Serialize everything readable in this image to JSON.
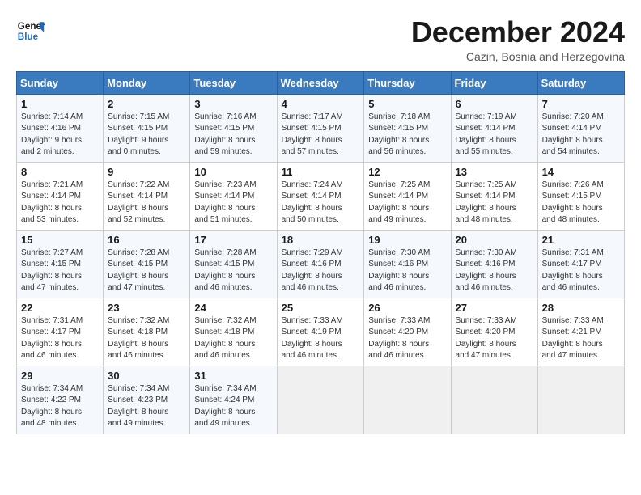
{
  "header": {
    "logo_general": "General",
    "logo_blue": "Blue",
    "month_title": "December 2024",
    "location": "Cazin, Bosnia and Herzegovina"
  },
  "calendar": {
    "days_of_week": [
      "Sunday",
      "Monday",
      "Tuesday",
      "Wednesday",
      "Thursday",
      "Friday",
      "Saturday"
    ],
    "weeks": [
      [
        {
          "day": "1",
          "info": "Sunrise: 7:14 AM\nSunset: 4:16 PM\nDaylight: 9 hours\nand 2 minutes."
        },
        {
          "day": "2",
          "info": "Sunrise: 7:15 AM\nSunset: 4:15 PM\nDaylight: 9 hours\nand 0 minutes."
        },
        {
          "day": "3",
          "info": "Sunrise: 7:16 AM\nSunset: 4:15 PM\nDaylight: 8 hours\nand 59 minutes."
        },
        {
          "day": "4",
          "info": "Sunrise: 7:17 AM\nSunset: 4:15 PM\nDaylight: 8 hours\nand 57 minutes."
        },
        {
          "day": "5",
          "info": "Sunrise: 7:18 AM\nSunset: 4:15 PM\nDaylight: 8 hours\nand 56 minutes."
        },
        {
          "day": "6",
          "info": "Sunrise: 7:19 AM\nSunset: 4:14 PM\nDaylight: 8 hours\nand 55 minutes."
        },
        {
          "day": "7",
          "info": "Sunrise: 7:20 AM\nSunset: 4:14 PM\nDaylight: 8 hours\nand 54 minutes."
        }
      ],
      [
        {
          "day": "8",
          "info": "Sunrise: 7:21 AM\nSunset: 4:14 PM\nDaylight: 8 hours\nand 53 minutes."
        },
        {
          "day": "9",
          "info": "Sunrise: 7:22 AM\nSunset: 4:14 PM\nDaylight: 8 hours\nand 52 minutes."
        },
        {
          "day": "10",
          "info": "Sunrise: 7:23 AM\nSunset: 4:14 PM\nDaylight: 8 hours\nand 51 minutes."
        },
        {
          "day": "11",
          "info": "Sunrise: 7:24 AM\nSunset: 4:14 PM\nDaylight: 8 hours\nand 50 minutes."
        },
        {
          "day": "12",
          "info": "Sunrise: 7:25 AM\nSunset: 4:14 PM\nDaylight: 8 hours\nand 49 minutes."
        },
        {
          "day": "13",
          "info": "Sunrise: 7:25 AM\nSunset: 4:14 PM\nDaylight: 8 hours\nand 48 minutes."
        },
        {
          "day": "14",
          "info": "Sunrise: 7:26 AM\nSunset: 4:15 PM\nDaylight: 8 hours\nand 48 minutes."
        }
      ],
      [
        {
          "day": "15",
          "info": "Sunrise: 7:27 AM\nSunset: 4:15 PM\nDaylight: 8 hours\nand 47 minutes."
        },
        {
          "day": "16",
          "info": "Sunrise: 7:28 AM\nSunset: 4:15 PM\nDaylight: 8 hours\nand 47 minutes."
        },
        {
          "day": "17",
          "info": "Sunrise: 7:28 AM\nSunset: 4:15 PM\nDaylight: 8 hours\nand 46 minutes."
        },
        {
          "day": "18",
          "info": "Sunrise: 7:29 AM\nSunset: 4:16 PM\nDaylight: 8 hours\nand 46 minutes."
        },
        {
          "day": "19",
          "info": "Sunrise: 7:30 AM\nSunset: 4:16 PM\nDaylight: 8 hours\nand 46 minutes."
        },
        {
          "day": "20",
          "info": "Sunrise: 7:30 AM\nSunset: 4:16 PM\nDaylight: 8 hours\nand 46 minutes."
        },
        {
          "day": "21",
          "info": "Sunrise: 7:31 AM\nSunset: 4:17 PM\nDaylight: 8 hours\nand 46 minutes."
        }
      ],
      [
        {
          "day": "22",
          "info": "Sunrise: 7:31 AM\nSunset: 4:17 PM\nDaylight: 8 hours\nand 46 minutes."
        },
        {
          "day": "23",
          "info": "Sunrise: 7:32 AM\nSunset: 4:18 PM\nDaylight: 8 hours\nand 46 minutes."
        },
        {
          "day": "24",
          "info": "Sunrise: 7:32 AM\nSunset: 4:18 PM\nDaylight: 8 hours\nand 46 minutes."
        },
        {
          "day": "25",
          "info": "Sunrise: 7:33 AM\nSunset: 4:19 PM\nDaylight: 8 hours\nand 46 minutes."
        },
        {
          "day": "26",
          "info": "Sunrise: 7:33 AM\nSunset: 4:20 PM\nDaylight: 8 hours\nand 46 minutes."
        },
        {
          "day": "27",
          "info": "Sunrise: 7:33 AM\nSunset: 4:20 PM\nDaylight: 8 hours\nand 47 minutes."
        },
        {
          "day": "28",
          "info": "Sunrise: 7:33 AM\nSunset: 4:21 PM\nDaylight: 8 hours\nand 47 minutes."
        }
      ],
      [
        {
          "day": "29",
          "info": "Sunrise: 7:34 AM\nSunset: 4:22 PM\nDaylight: 8 hours\nand 48 minutes."
        },
        {
          "day": "30",
          "info": "Sunrise: 7:34 AM\nSunset: 4:23 PM\nDaylight: 8 hours\nand 49 minutes."
        },
        {
          "day": "31",
          "info": "Sunrise: 7:34 AM\nSunset: 4:24 PM\nDaylight: 8 hours\nand 49 minutes."
        },
        {
          "day": "",
          "info": ""
        },
        {
          "day": "",
          "info": ""
        },
        {
          "day": "",
          "info": ""
        },
        {
          "day": "",
          "info": ""
        }
      ]
    ]
  }
}
